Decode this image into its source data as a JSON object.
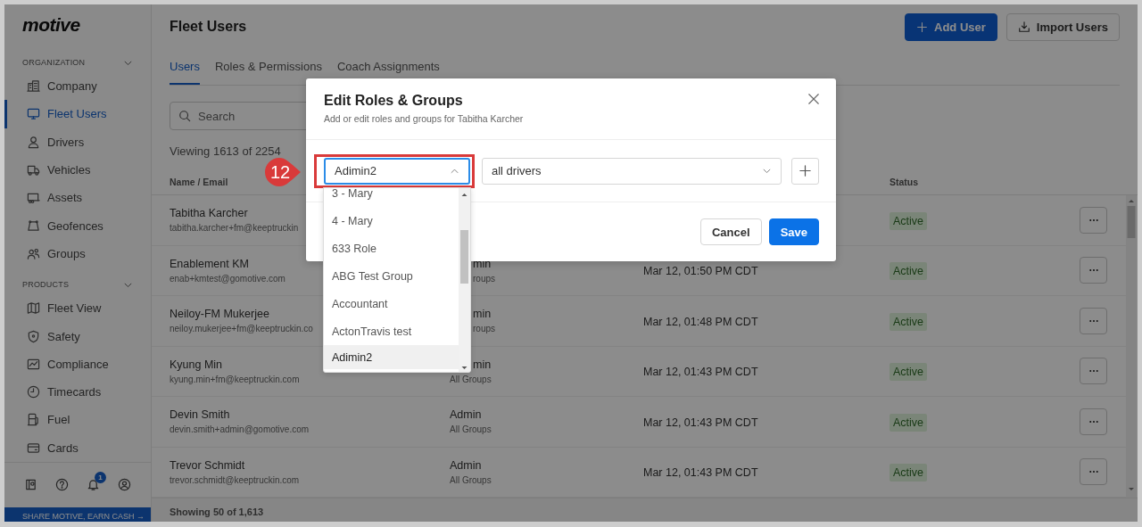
{
  "sidebar": {
    "logo": "motive",
    "sections": [
      {
        "title": "ORGANIZATION",
        "expanded": true,
        "items": [
          {
            "label": "Company",
            "selected": false
          },
          {
            "label": "Fleet Users",
            "selected": true
          },
          {
            "label": "Drivers",
            "selected": false
          },
          {
            "label": "Vehicles",
            "selected": false
          },
          {
            "label": "Assets",
            "selected": false
          },
          {
            "label": "Geofences",
            "selected": false
          },
          {
            "label": "Groups",
            "selected": false
          }
        ]
      },
      {
        "title": "PRODUCTS",
        "expanded": true,
        "items": [
          {
            "label": "Fleet View",
            "selected": false
          },
          {
            "label": "Safety",
            "selected": false
          },
          {
            "label": "Compliance",
            "selected": false
          },
          {
            "label": "Timecards",
            "selected": false
          },
          {
            "label": "Fuel",
            "selected": false
          },
          {
            "label": "Cards",
            "selected": false
          }
        ]
      }
    ],
    "notification_badge": "1",
    "promo": "SHARE MOTIVE, EARN CASH →"
  },
  "header": {
    "title": "Fleet Users",
    "buttons": [
      {
        "label": "Add User",
        "kind": "primary"
      },
      {
        "label": "Import Users",
        "kind": "secondary"
      }
    ]
  },
  "tabs": [
    {
      "label": "Users",
      "selected": true
    },
    {
      "label": "Roles & Permissions",
      "selected": false
    },
    {
      "label": "Coach Assignments",
      "selected": false
    }
  ],
  "search": {
    "placeholder": "Search"
  },
  "viewing": "Viewing 1613 of 2254",
  "table": {
    "columns": [
      {
        "label": "Name / Email"
      },
      {
        "label": "Status"
      }
    ],
    "rows": [
      {
        "name": "Tabitha Karcher",
        "email": "tabitha.karcher+fm@keeptruckin",
        "status": "Active"
      },
      {
        "name": "Enablement KM",
        "email": "enab+kmtest@gomotive.com",
        "role_tail": "min",
        "groups_tail": "roups",
        "last_active": "Mar 12, 01:50 PM CDT",
        "status": "Active"
      },
      {
        "name": "Neiloy-FM Mukerjee",
        "email": "neiloy.mukerjee+fm@keeptruckin.co",
        "role_tail": "min",
        "groups_tail": "roups",
        "last_active": "Mar 12, 01:48 PM CDT",
        "status": "Active"
      },
      {
        "name": "Kyung Min",
        "email": "kyung.min+fm@keeptruckin.com",
        "role_tail": "min",
        "groups": "All Groups",
        "last_active": "Mar 12, 01:43 PM CDT",
        "status": "Active"
      },
      {
        "name": "Devin Smith",
        "email": "devin.smith+admin@gomotive.com",
        "role": "Admin",
        "groups": "All Groups",
        "last_active": "Mar 12, 01:43 PM CDT",
        "status": "Active"
      },
      {
        "name": "Trevor Schmidt",
        "email": "trevor.schmidt@keeptruckin.com",
        "role": "Admin",
        "groups": "All Groups",
        "last_active": "Mar 12, 01:43 PM CDT",
        "status": "Active"
      }
    ],
    "footer": "Showing 50 of 1,613"
  },
  "modal": {
    "title": "Edit Roles & Groups",
    "subtitle": "Add or edit roles and groups for Tabitha Karcher",
    "role_select": {
      "value": "Adimin2",
      "expanded": true,
      "options": [
        {
          "label": "3 - Mary",
          "selected": false
        },
        {
          "label": "4 - Mary",
          "selected": false
        },
        {
          "label": "633 Role",
          "selected": false
        },
        {
          "label": "ABG Test Group",
          "selected": false
        },
        {
          "label": "Accountant",
          "selected": false
        },
        {
          "label": "ActonTravis test",
          "selected": false
        },
        {
          "label": "Adimin2",
          "selected": true
        }
      ]
    },
    "group_select": {
      "value": "all drivers"
    },
    "buttons": [
      {
        "label": "Cancel",
        "kind": "secondary"
      },
      {
        "label": "Save",
        "kind": "primary"
      }
    ]
  },
  "callout": {
    "label": "12"
  }
}
